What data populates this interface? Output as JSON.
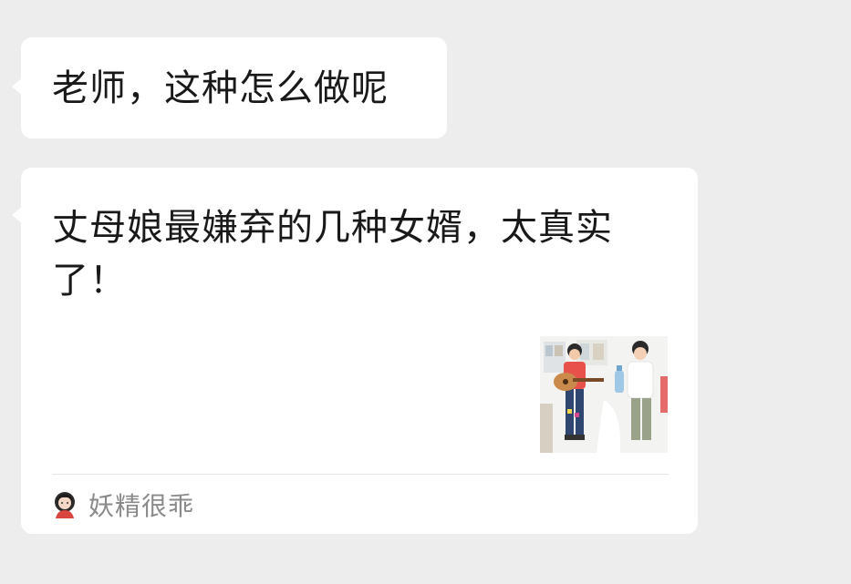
{
  "messages": [
    {
      "text": "老师，这种怎么做呢"
    },
    {
      "card": {
        "title": "丈母娘最嫌弃的几种女婿，太真实了！",
        "thumbnail_icon": "article-thumbnail-illustration",
        "source_icon": "account-avatar-icon",
        "source_name": "妖精很乖"
      }
    }
  ],
  "colors": {
    "background": "#ededed",
    "bubble": "#ffffff",
    "text": "#191919",
    "source_text": "#8a8a8a"
  }
}
